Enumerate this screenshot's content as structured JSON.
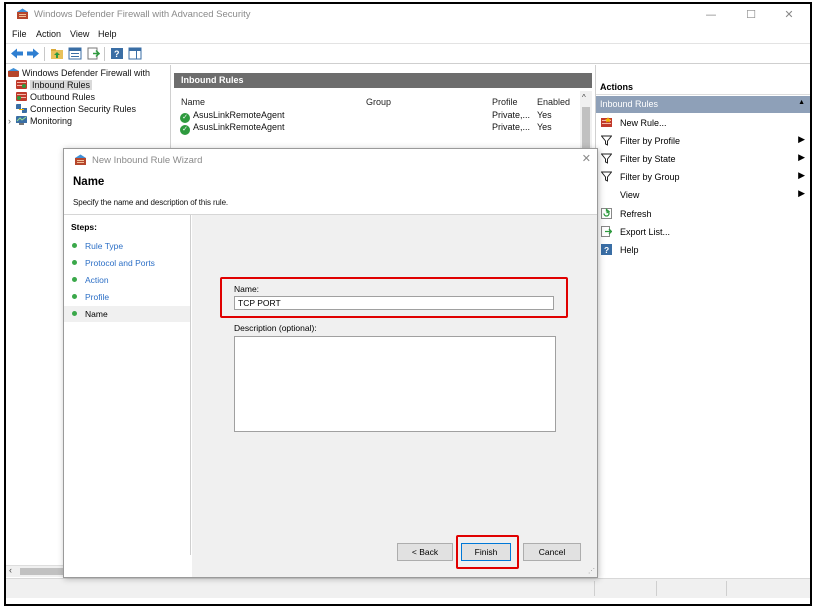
{
  "window": {
    "title": "Windows Defender Firewall with Advanced Security",
    "controls": {
      "minimize": "—",
      "maximize": "☐",
      "close": "✕"
    }
  },
  "menu": [
    "File",
    "Action",
    "View",
    "Help"
  ],
  "tree": {
    "root": "Windows Defender Firewall with",
    "items": [
      {
        "label": "Inbound Rules",
        "selected": true
      },
      {
        "label": "Outbound Rules",
        "selected": false
      },
      {
        "label": "Connection Security Rules",
        "selected": false
      },
      {
        "label": "Monitoring",
        "selected": false
      }
    ],
    "expander": "›",
    "scroll_left": "‹"
  },
  "rules_pane": {
    "title": "Inbound Rules",
    "columns": [
      "Name",
      "Group",
      "Profile",
      "Enabled"
    ],
    "rows": [
      {
        "name": "AsusLinkRemoteAgent",
        "group": "",
        "profile": "Private,...",
        "enabled": "Yes"
      },
      {
        "name": "AsusLinkRemoteAgent",
        "group": "",
        "profile": "Private,...",
        "enabled": "Yes"
      }
    ],
    "scroll_up": "^"
  },
  "actions": {
    "title": "Actions",
    "group": "Inbound Rules",
    "items": [
      {
        "label": "New Rule...",
        "icon": "new-rule-icon",
        "submenu": false
      },
      {
        "label": "Filter by Profile",
        "icon": "filter-icon",
        "submenu": true
      },
      {
        "label": "Filter by State",
        "icon": "filter-icon",
        "submenu": true
      },
      {
        "label": "Filter by Group",
        "icon": "filter-icon",
        "submenu": true
      },
      {
        "label": "View",
        "icon": "",
        "submenu": true
      },
      {
        "label": "Refresh",
        "icon": "refresh-icon",
        "submenu": false
      },
      {
        "label": "Export List...",
        "icon": "export-icon",
        "submenu": false
      },
      {
        "label": "Help",
        "icon": "help-icon",
        "submenu": false
      }
    ],
    "submenu_arrow": "▶",
    "collapse_caret": "▲"
  },
  "wizard": {
    "title": "New Inbound Rule Wizard",
    "close": "✕",
    "heading": "Name",
    "subheading": "Specify the name and description of this rule.",
    "steps_title": "Steps:",
    "steps": [
      {
        "label": "Rule Type",
        "current": false
      },
      {
        "label": "Protocol and Ports",
        "current": false
      },
      {
        "label": "Action",
        "current": false
      },
      {
        "label": "Profile",
        "current": false
      },
      {
        "label": "Name",
        "current": true
      }
    ],
    "name_label": "Name:",
    "name_value": "TCP PORT",
    "description_label": "Description (optional):",
    "description_value": "",
    "buttons": {
      "back": "< Back",
      "finish": "Finish",
      "cancel": "Cancel"
    },
    "highlight_color": "#e00000"
  },
  "colors": {
    "accent_header": "#6d6d6d",
    "actions_group": "#8ea0b8",
    "step_link": "#2c6fc6",
    "step_dot": "#3aa84a"
  }
}
